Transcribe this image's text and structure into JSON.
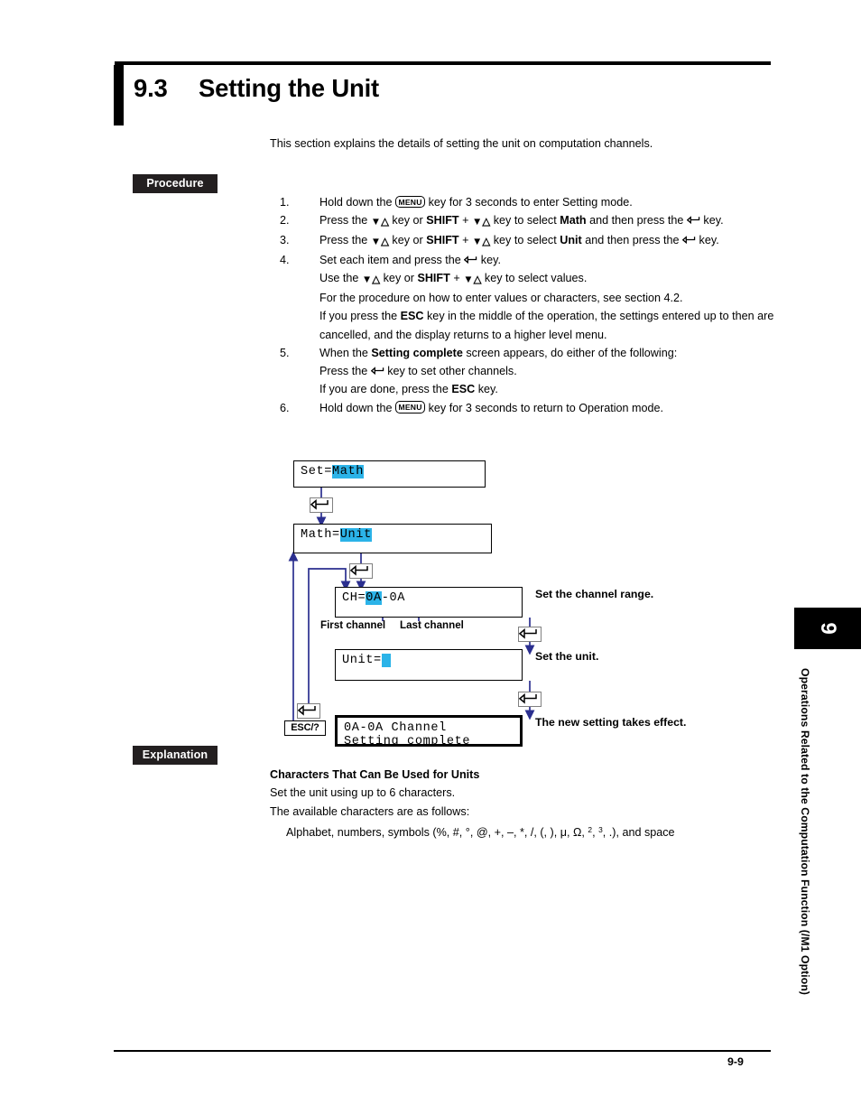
{
  "header": {
    "section_number": "9.3",
    "title": "Setting the Unit"
  },
  "intro": "This section explains the details of setting the unit on computation channels.",
  "tags": {
    "procedure": "Procedure",
    "explanation": "Explanation"
  },
  "procedure": {
    "steps": [
      {
        "number": "1.",
        "parts": [
          {
            "t": "Hold down the "
          },
          {
            "key": "MENU"
          },
          {
            "t": " key for 3 seconds to enter Setting mode."
          }
        ]
      },
      {
        "number": "2.",
        "parts": [
          {
            "t": "Press the "
          },
          {
            "arrows": "▼△"
          },
          {
            "t": " key or "
          },
          {
            "b": "SHIFT"
          },
          {
            "t": " + "
          },
          {
            "arrows": "▼△"
          },
          {
            "t": " key to select "
          },
          {
            "b": "Math"
          },
          {
            "t": " and then press the "
          },
          {
            "enter": true
          },
          {
            "t": " key."
          }
        ]
      },
      {
        "number": "3.",
        "parts": [
          {
            "t": "Press the "
          },
          {
            "arrows": "▼△"
          },
          {
            "t": " key or "
          },
          {
            "b": "SHIFT"
          },
          {
            "t": " + "
          },
          {
            "arrows": "▼△"
          },
          {
            "t": " key to select "
          },
          {
            "b": "Unit"
          },
          {
            "t": " and then press the "
          },
          {
            "enter": true
          },
          {
            "t": " key."
          }
        ]
      },
      {
        "number": "4.",
        "parts": [
          {
            "t": "Set each item and press the "
          },
          {
            "enter": true
          },
          {
            "t": " key."
          }
        ],
        "sublines": [
          [
            {
              "t": "Use the "
            },
            {
              "arrows": "▼△"
            },
            {
              "t": " key or "
            },
            {
              "b": "SHIFT"
            },
            {
              "t": " + "
            },
            {
              "arrows": "▼△"
            },
            {
              "t": " key to select values."
            }
          ],
          [
            {
              "t": "For the procedure on how to enter values or characters, see section 4.2."
            }
          ],
          [
            {
              "t": "If you press the "
            },
            {
              "b": "ESC"
            },
            {
              "t": " key in the middle of the operation, the settings entered up to then are cancelled, and the display returns to a higher level menu."
            }
          ]
        ]
      },
      {
        "number": "5.",
        "parts": [
          {
            "t": "When the "
          },
          {
            "b": "Setting complete"
          },
          {
            "t": " screen appears, do either of the following:"
          }
        ],
        "sublines": [
          [
            {
              "t": "Press the "
            },
            {
              "enter": true
            },
            {
              "t": " key to set other channels."
            }
          ],
          [
            {
              "t": "If you are done, press the "
            },
            {
              "b": "ESC"
            },
            {
              "t": " key."
            }
          ]
        ]
      },
      {
        "number": "6.",
        "parts": [
          {
            "t": "Hold down the "
          },
          {
            "key": "MENU"
          },
          {
            "t": " key for 3 seconds to return to Operation mode."
          }
        ]
      }
    ]
  },
  "diagram": {
    "screens": [
      {
        "id": "set-math",
        "lines": [
          [
            {
              "t": "Set="
            },
            {
              "t": "Math",
              "hl": true
            }
          ]
        ]
      },
      {
        "id": "math-unit",
        "lines": [
          [
            {
              "t": "Math="
            },
            {
              "t": "Unit",
              "hl": true
            }
          ]
        ]
      },
      {
        "id": "ch-range",
        "lines": [
          [
            {
              "t": "CH="
            },
            {
              "t": "0A",
              "hl": true
            },
            {
              "t": "-0A"
            }
          ]
        ]
      },
      {
        "id": "unit-entry",
        "lines": [
          [
            {
              "t": "Unit="
            },
            {
              "cursor": true
            }
          ]
        ]
      },
      {
        "id": "setting-complete",
        "lines": [
          [
            {
              "t": "0A-0A Channel"
            }
          ],
          [
            {
              "t": "Setting complete"
            }
          ]
        ]
      }
    ],
    "callouts": {
      "first_channel": "First channel",
      "last_channel": "Last channel"
    },
    "right_labels": [
      "Set the channel range.",
      "Set the unit.",
      "The new setting takes effect."
    ],
    "esc_key_label": "ESC/?",
    "enter_key_icon": "enter-key-icon",
    "arrow_color": "#2b2f8f",
    "highlight_color": "#2bb3e8"
  },
  "explanation": {
    "heading": "Characters That Can Be Used for Units",
    "line1": "Set the unit using up to 6 characters.",
    "line2": "The available characters are as follows:",
    "charlist_prefix": "Alphabet, numbers, symbols (%, #, °, @, +, –, *, /, (, ), μ, Ω, ",
    "charlist_sup1": "2",
    "charlist_mid": ", ",
    "charlist_sup2": "3",
    "charlist_suffix": ", .), and space"
  },
  "sidebar": {
    "chapter_number": "9",
    "chapter_title": "Operations Related to the Computation Function (/M1 Option)"
  },
  "footer": {
    "page": "9-9"
  }
}
